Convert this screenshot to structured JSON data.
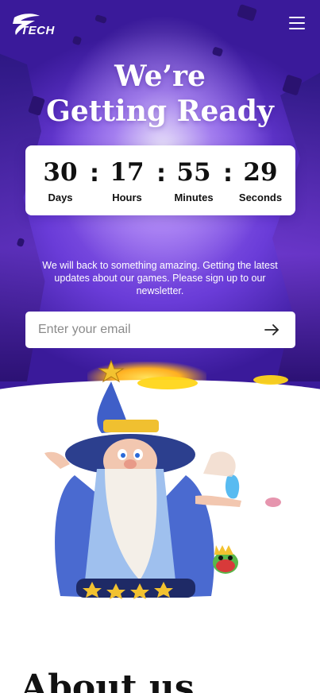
{
  "brand": {
    "logo_text": "TECH"
  },
  "hero": {
    "headline_line1": "We’re",
    "headline_line2": "Getting Ready"
  },
  "countdown": {
    "days": "30",
    "days_label": "Days",
    "hours": "17",
    "hours_label": "Hours",
    "minutes": "55",
    "minutes_label": "Minutes",
    "seconds": "29",
    "seconds_label": "Seconds",
    "separator": ":"
  },
  "newsletter": {
    "description": "We will back to something amazing. Getting the latest updates about our games. Please sign up to our newsletter.",
    "placeholder": "Enter your email",
    "submit_icon": "arrow-right-icon"
  },
  "icons": {
    "menu": "hamburger-menu-icon",
    "logo": "s-swirl-logo"
  },
  "about": {
    "heading": "About us"
  },
  "colors": {
    "hero_purple": "#5a2fd6",
    "card_white": "#ffffff",
    "text_dark": "#111111"
  }
}
